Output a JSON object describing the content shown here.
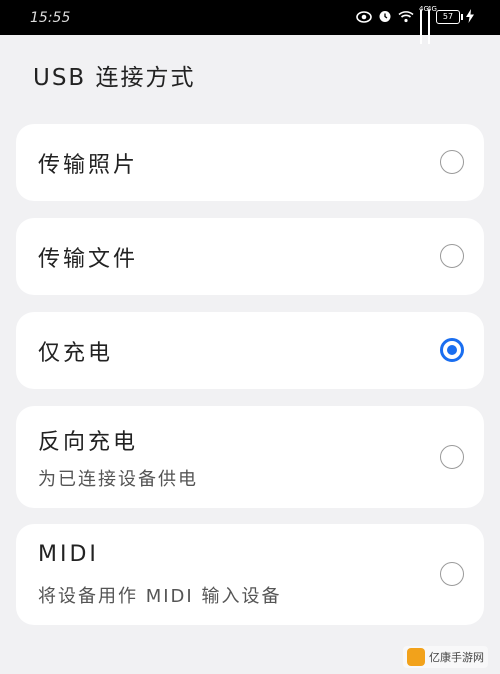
{
  "status": {
    "time": "15:55",
    "network_tag_1": "4G",
    "network_tag_2": "4G",
    "battery": "57",
    "icons": [
      "eye-icon",
      "alarm-icon",
      "wifi-icon",
      "signal-icon",
      "signal-icon",
      "battery-icon",
      "charging-icon"
    ]
  },
  "page": {
    "title": "USB 连接方式"
  },
  "options": [
    {
      "label": "传输照片",
      "sub": "",
      "checked": false
    },
    {
      "label": "传输文件",
      "sub": "",
      "checked": false
    },
    {
      "label": "仅充电",
      "sub": "",
      "checked": true
    },
    {
      "label": "反向充电",
      "sub": "为已连接设备供电",
      "checked": false
    },
    {
      "label": "MIDI",
      "sub": "将设备用作 MIDI 输入设备",
      "checked": false
    }
  ],
  "watermark": {
    "text": "亿康手游网"
  },
  "colors": {
    "accent": "#1a6ef0",
    "background": "#f1f1f3",
    "card": "#ffffff"
  }
}
